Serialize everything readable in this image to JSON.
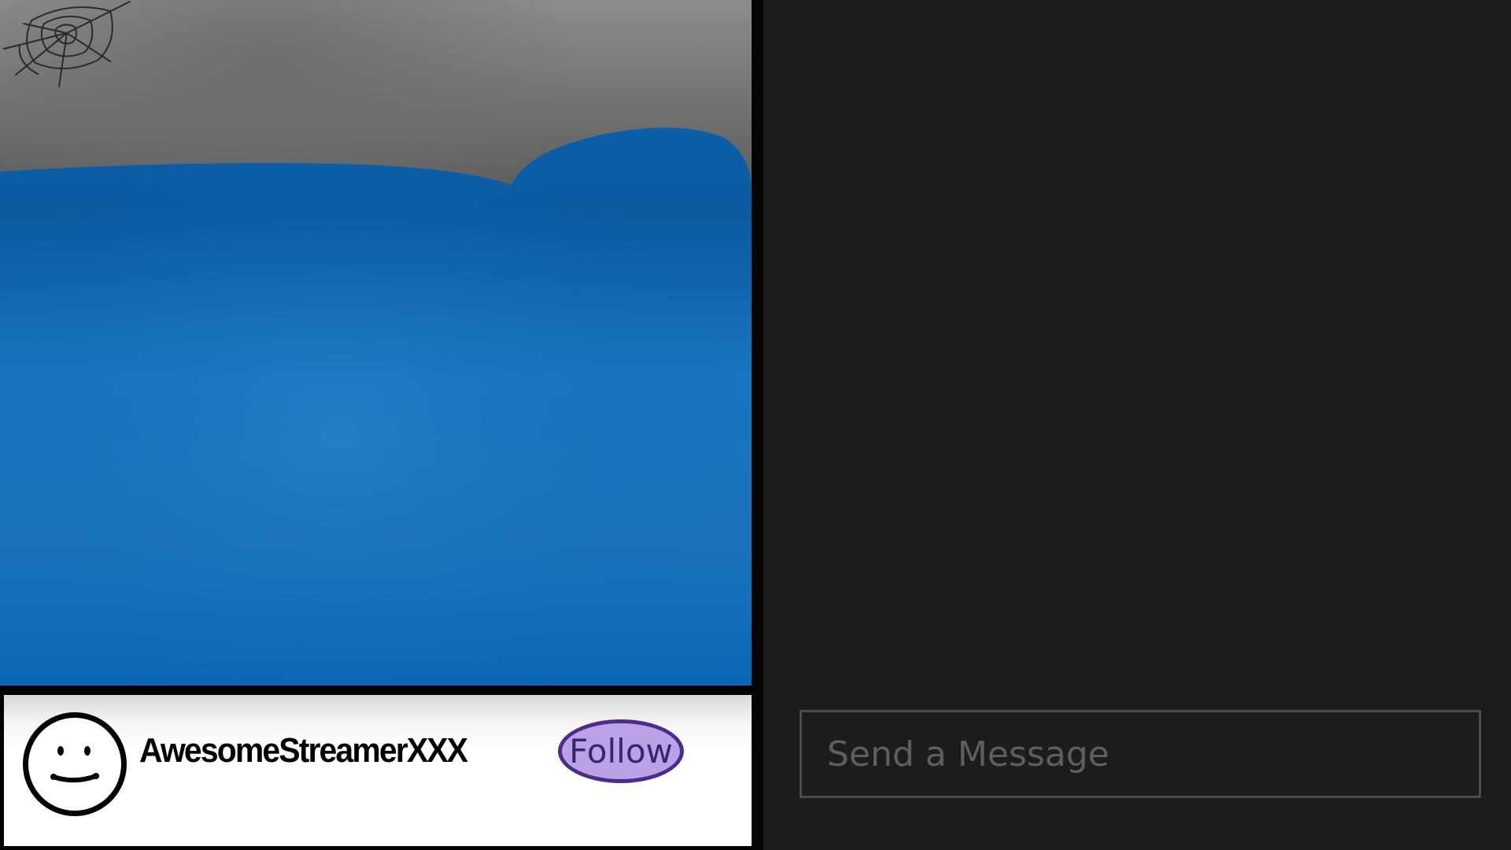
{
  "streamer": {
    "name": "AwesomeStreamerXXX",
    "avatar_icon": "smiley-face-icon"
  },
  "follow_button": {
    "label": "Follow",
    "fill_color": "#b9a2e6",
    "border_color": "#4f2a8c"
  },
  "chat": {
    "input_placeholder": "Send a Message",
    "input_value": "",
    "background_color": "#1c1c1c"
  },
  "video": {
    "water_color": "#0a66b8",
    "decoration_icon": "cobweb-icon"
  }
}
